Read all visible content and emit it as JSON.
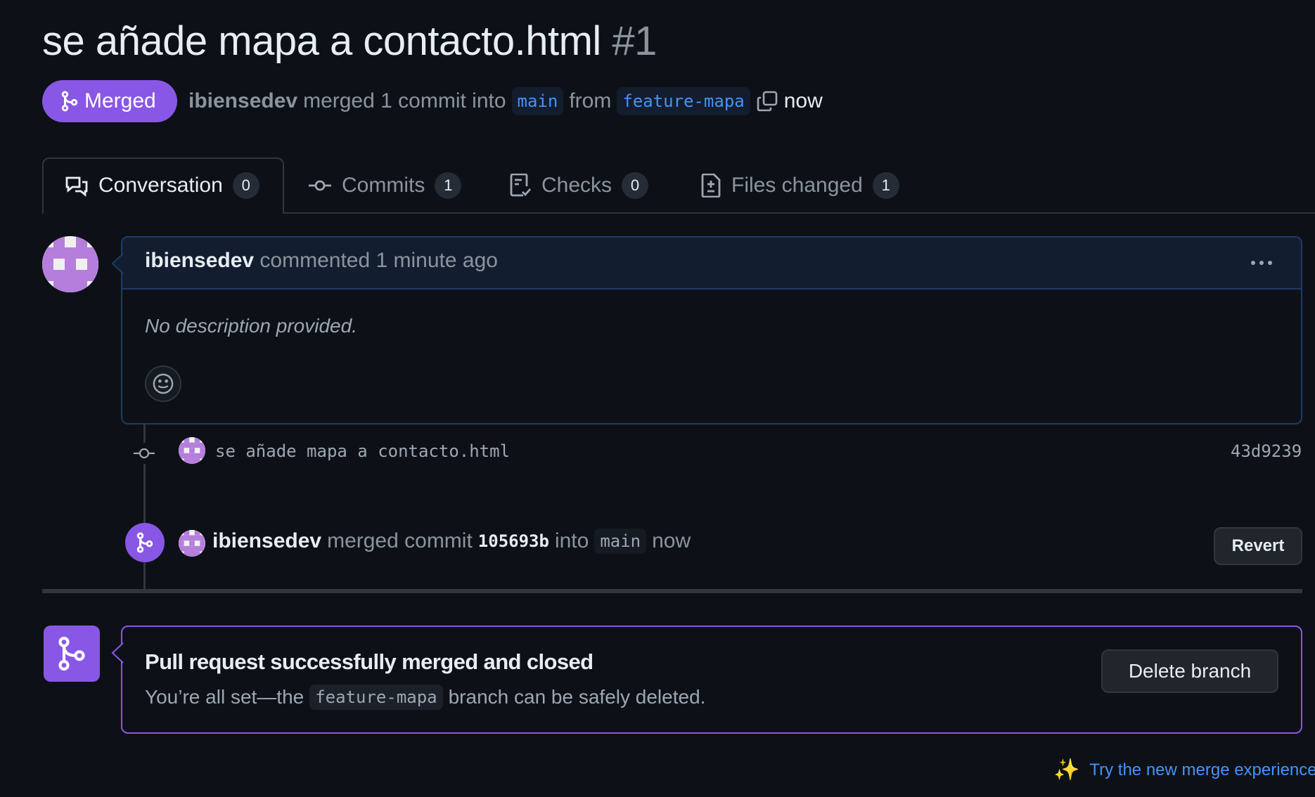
{
  "pr": {
    "title": "se añade mapa a contacto.html",
    "number": "#1"
  },
  "status_badge": {
    "label": "Merged",
    "color": "#8957e5",
    "icon": "git-merge-icon"
  },
  "meta": {
    "author": "ibiensedev",
    "merged_text": "merged 1 commit into",
    "base_branch": "main",
    "from_text": "from",
    "head_branch": "feature-mapa",
    "copy_icon": "copy-icon",
    "time": "now"
  },
  "tabs": [
    {
      "label": "Conversation",
      "count": "0",
      "icon": "comment-discussion-icon",
      "active": true
    },
    {
      "label": "Commits",
      "count": "1",
      "icon": "git-commit-icon"
    },
    {
      "label": "Checks",
      "count": "0",
      "icon": "checklist-icon"
    },
    {
      "label": "Files changed",
      "count": "1",
      "icon": "file-diff-icon"
    }
  ],
  "comment": {
    "author": "ibiensedev",
    "action": "commented 1 minute ago",
    "body": "No description provided.",
    "more_icon": "kebab-horizontal-icon",
    "reaction_icon": "smiley-icon"
  },
  "timeline": {
    "commit": {
      "message": "se añade mapa a contacto.html",
      "sha": "43d9239"
    },
    "merge_event": {
      "author": "ibiensedev",
      "text1": "merged commit",
      "sha": "105693b",
      "text2": "into",
      "branch": "main",
      "time": "now",
      "revert_label": "Revert"
    }
  },
  "merged_box": {
    "title": "Pull request successfully merged and closed",
    "desc_before": "You’re all set—the",
    "branch": "feature-mapa",
    "desc_after": "branch can be safely deleted.",
    "delete_label": "Delete branch"
  },
  "footer": {
    "sparkle": "✨",
    "link": "Try the new merge experience"
  },
  "colors": {
    "background": "#0d1117",
    "merged_purple": "#8957e5",
    "link_blue": "#4493f8",
    "border": "#30363d"
  }
}
